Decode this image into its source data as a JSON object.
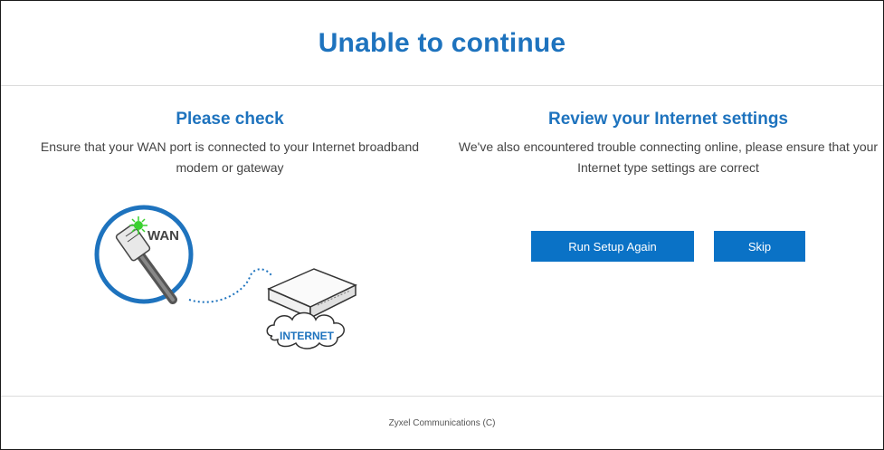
{
  "page": {
    "title": "Unable to continue",
    "footer": "Zyxel Communications (C)"
  },
  "left": {
    "heading": "Please check",
    "description": "Ensure that your WAN port is connected to your Internet broadband modem or gateway",
    "illustration": {
      "port_label": "WAN",
      "cloud_label": "INTERNET"
    }
  },
  "right": {
    "heading": "Review your Internet settings",
    "description": "We've also encountered trouble connecting online, please ensure that your Internet type settings are correct"
  },
  "buttons": {
    "run_setup": "Run Setup Again",
    "skip": "Skip"
  },
  "colors": {
    "accent": "#1e73be",
    "button": "#0a72c6",
    "status_light": "#3ad12e"
  }
}
